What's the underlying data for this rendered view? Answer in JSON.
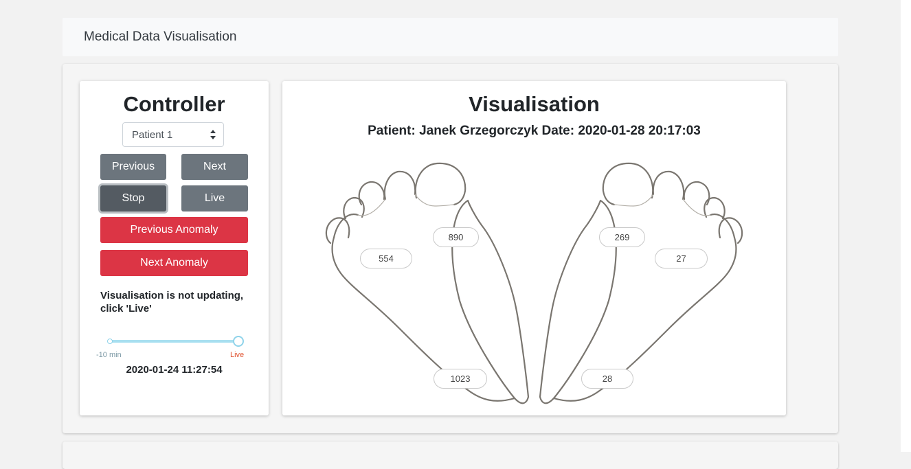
{
  "navbar": {
    "brand": "Medical Data Visualisation"
  },
  "controller": {
    "title": "Controller",
    "patient_select": {
      "value": "Patient 1"
    },
    "buttons": {
      "previous": "Previous",
      "next": "Next",
      "stop": "Stop",
      "live": "Live",
      "previous_anomaly": "Previous Anomaly",
      "next_anomaly": "Next Anomaly"
    },
    "status_message": "Visualisation is not updating, click 'Live'",
    "slider": {
      "min_label": "-10 min",
      "max_label": "Live",
      "position": 1.0,
      "timestamp": "2020-01-24 11:27:54"
    }
  },
  "visualisation": {
    "title": "Visualisation",
    "subtitle": "Patient: Janek Grzegorczyk Date: 2020-01-28 20:17:03",
    "left_foot": {
      "sensor_1": "890",
      "sensor_2": "554",
      "sensor_3": "1023"
    },
    "right_foot": {
      "sensor_1": "269",
      "sensor_2": "27",
      "sensor_3": "28"
    }
  },
  "colors": {
    "danger": "#dc3545",
    "secondary": "#6c757d",
    "slider": "#a8dff0",
    "live_label": "#e05533"
  },
  "icons": [
    "select-arrows-icon"
  ]
}
